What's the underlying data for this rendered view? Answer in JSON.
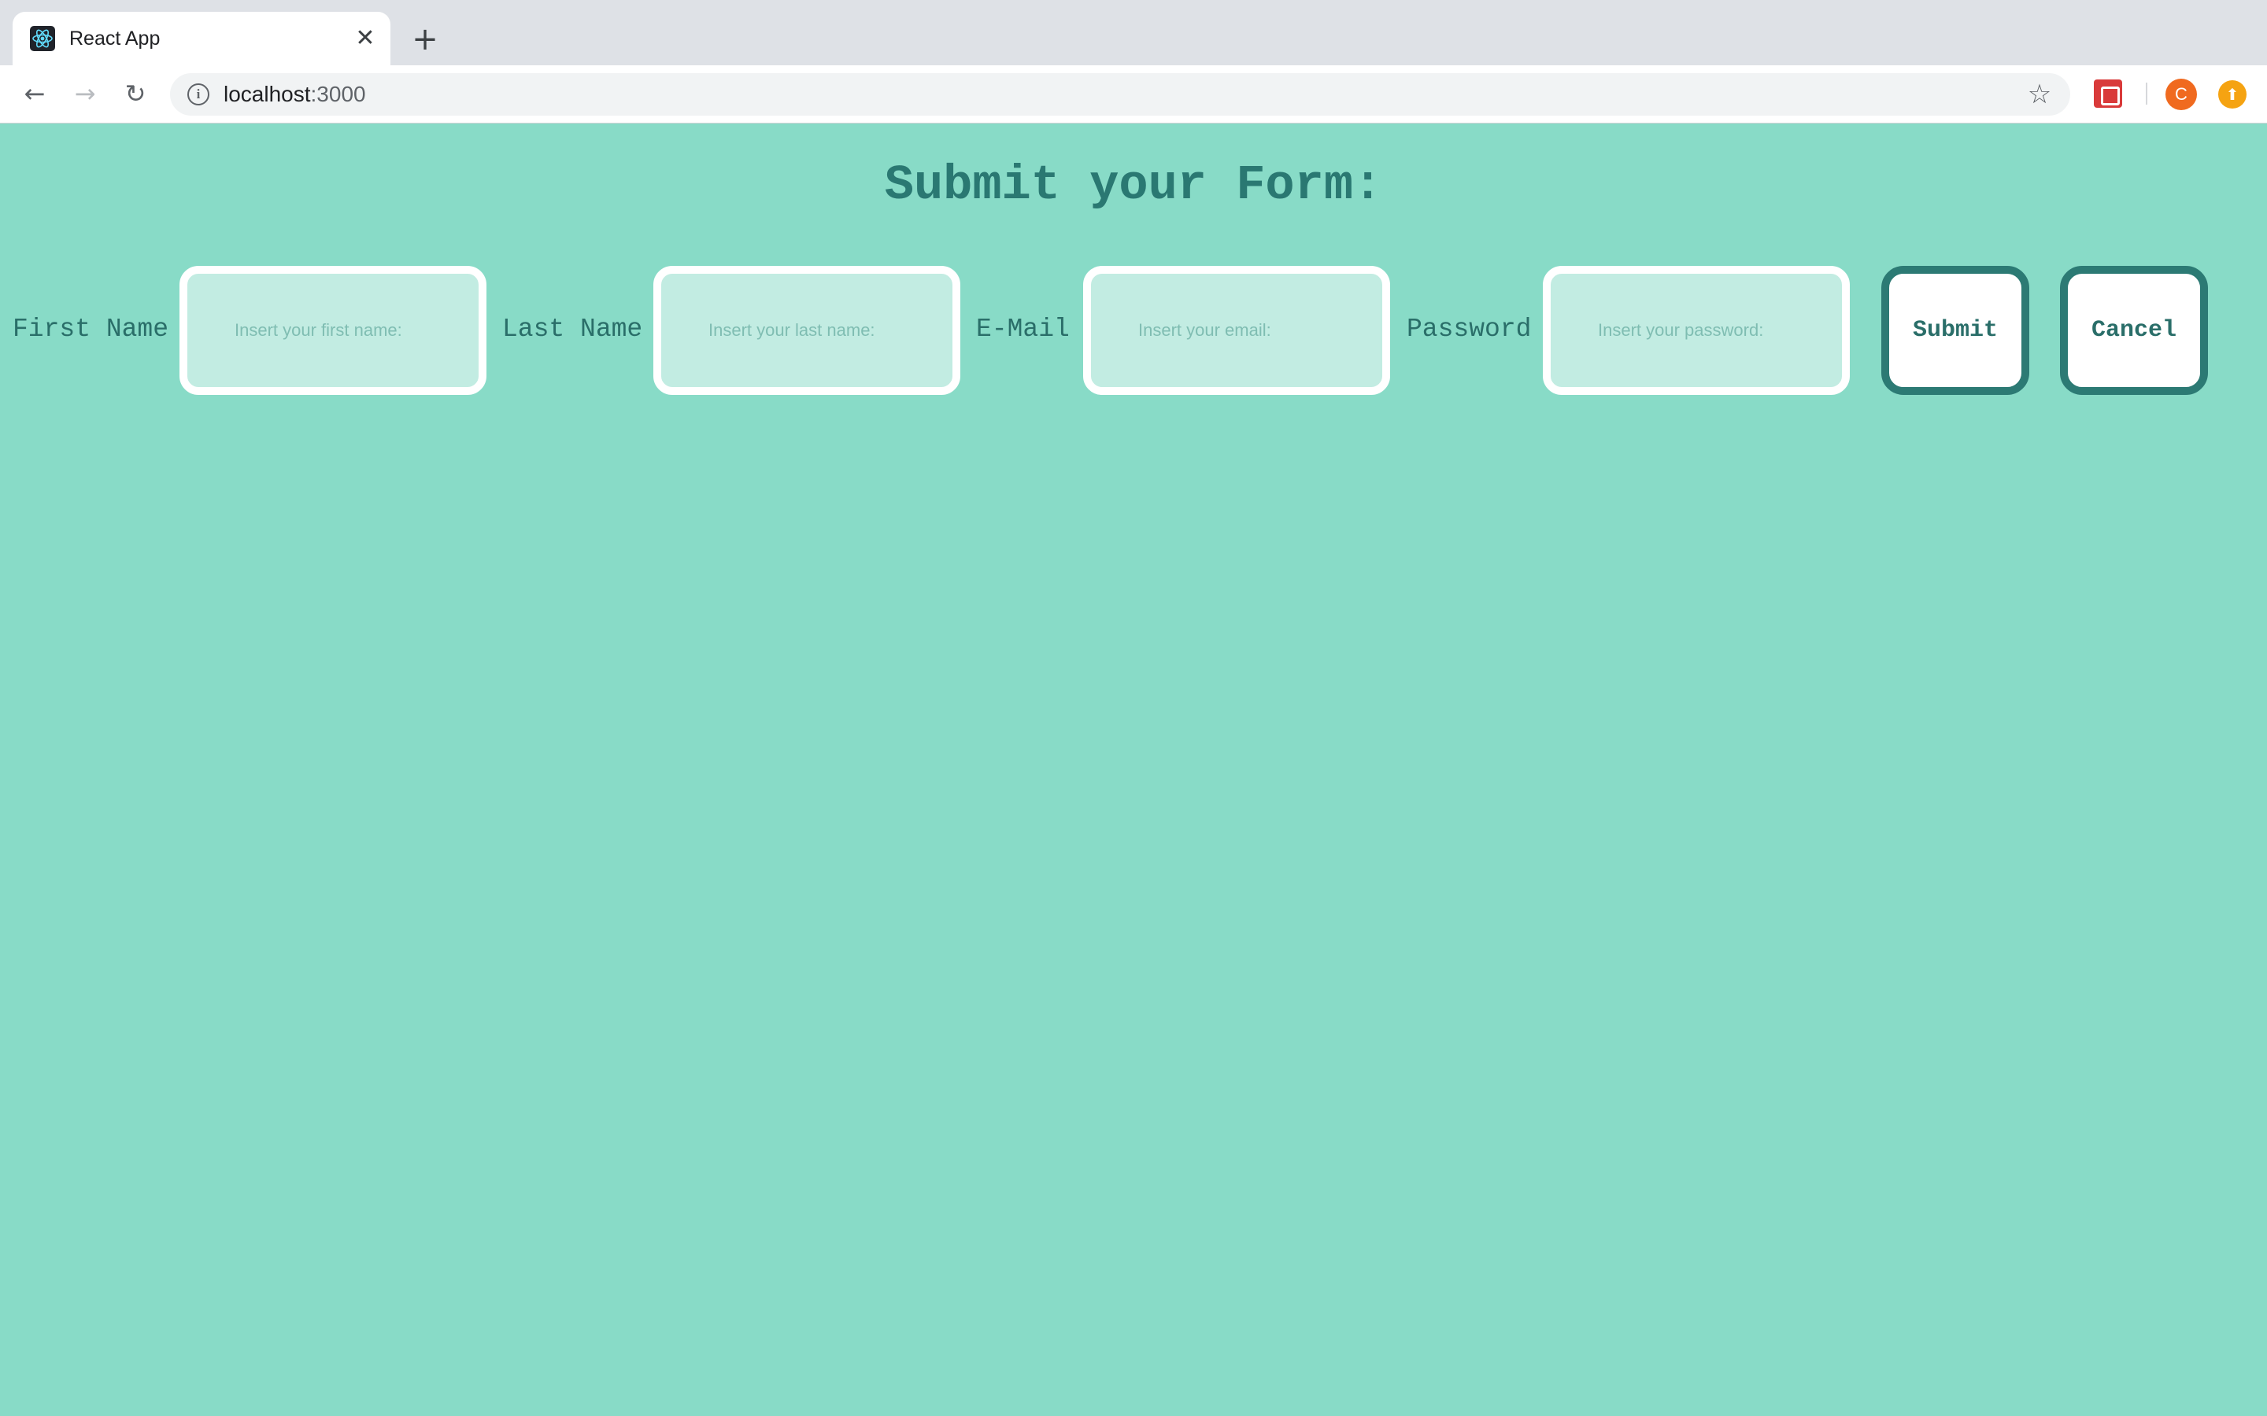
{
  "browser": {
    "tab_title": "React App",
    "tab_close": "✕",
    "new_tab": "+",
    "url_host": "localhost",
    "url_port": ":3000",
    "nav": {
      "back": "←",
      "forward": "→",
      "reload": "↻"
    },
    "star": "☆",
    "info": "i",
    "avatar_initial": "C",
    "update_symbol": "⬆"
  },
  "page": {
    "title": "Submit your Form:"
  },
  "form": {
    "first_name": {
      "label": "First Name",
      "placeholder": "Insert your first name:"
    },
    "last_name": {
      "label": "Last Name",
      "placeholder": "Insert your last name:"
    },
    "email": {
      "label": "E-Mail",
      "placeholder": "Insert your email:"
    },
    "password": {
      "label": "Password",
      "placeholder": "Insert your password:"
    },
    "submit_label": "Submit",
    "cancel_label": "Cancel"
  },
  "colors": {
    "background": "#88dbc7",
    "accent": "#2a7872",
    "field_fill": "#c2ece2",
    "field_border": "#ffffff",
    "button_border": "#2c7a74"
  }
}
